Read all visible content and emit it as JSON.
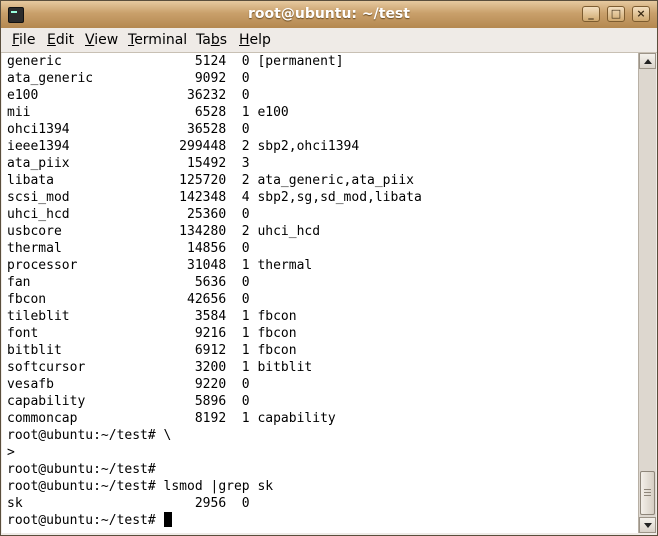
{
  "window": {
    "title": "root@ubuntu: ~/test"
  },
  "menu": {
    "items": [
      {
        "key": "F",
        "rest": "ile"
      },
      {
        "key": "E",
        "rest": "dit"
      },
      {
        "key": "V",
        "rest": "iew"
      },
      {
        "key": "T",
        "rest": "erminal"
      },
      {
        "pre": "Ta",
        "key": "b",
        "rest": "s"
      },
      {
        "key": "H",
        "rest": "elp"
      }
    ]
  },
  "terminal": {
    "lines": [
      "generic                 5124  0 [permanent]",
      "ata_generic             9092  0",
      "e100                   36232  0",
      "mii                     6528  1 e100",
      "ohci1394               36528  0",
      "ieee1394              299448  2 sbp2,ohci1394",
      "ata_piix               15492  3",
      "libata                125720  2 ata_generic,ata_piix",
      "scsi_mod              142348  4 sbp2,sg,sd_mod,libata",
      "uhci_hcd               25360  0",
      "usbcore               134280  2 uhci_hcd",
      "thermal                14856  0",
      "processor              31048  1 thermal",
      "fan                     5636  0",
      "fbcon                  42656  0",
      "tileblit                3584  1 fbcon",
      "font                    9216  1 fbcon",
      "bitblit                 6912  1 fbcon",
      "softcursor              3200  1 bitblit",
      "vesafb                  9220  0",
      "capability              5896  0",
      "commoncap               8192  1 capability",
      "root@ubuntu:~/test# \\",
      ">",
      "root@ubuntu:~/test#",
      "root@ubuntu:~/test# lsmod |grep sk",
      "sk                      2956  0"
    ],
    "prompt": "root@ubuntu:~/test# "
  }
}
